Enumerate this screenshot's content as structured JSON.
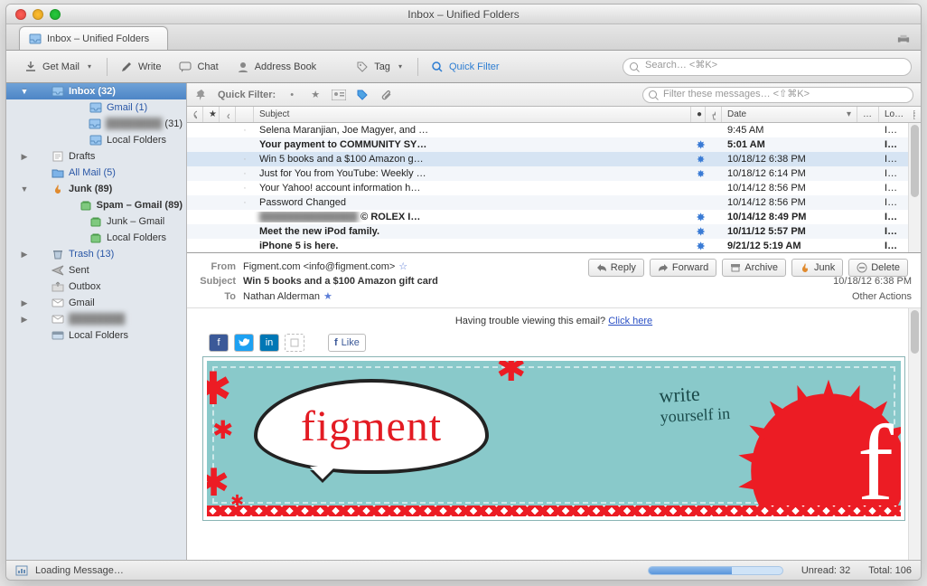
{
  "window": {
    "title": "Inbox – Unified Folders"
  },
  "tab": {
    "label": "Inbox – Unified Folders"
  },
  "toolbar": {
    "get_mail": "Get Mail",
    "write": "Write",
    "chat": "Chat",
    "address_book": "Address Book",
    "tag": "Tag",
    "quick_filter": "Quick Filter",
    "search_placeholder": "Search… <⌘K>"
  },
  "sidebar": {
    "items": [
      {
        "label": "Inbox (32)",
        "icon": "inbox",
        "indent": 1,
        "selected": true,
        "disclosure": "▼"
      },
      {
        "label": "Gmail (1)",
        "icon": "inbox",
        "indent": 2,
        "blue": true
      },
      {
        "label_plain": "",
        "label_suffix": "(31)",
        "icon": "inbox",
        "indent": 2,
        "blurred": true
      },
      {
        "label": "Local Folders",
        "icon": "inbox",
        "indent": 2
      },
      {
        "label": "Drafts",
        "icon": "drafts",
        "indent": 1,
        "disclosure": "▶"
      },
      {
        "label": "All Mail (5)",
        "icon": "folder-blue",
        "indent": 1,
        "blue": true
      },
      {
        "label": "Junk (89)",
        "icon": "junk",
        "indent": 1,
        "disclosure": "▼",
        "bold": true
      },
      {
        "label": "Spam – Gmail (89)",
        "icon": "junk-green",
        "indent": 2,
        "bold": true
      },
      {
        "label": "Junk – Gmail",
        "icon": "junk-green",
        "indent": 2
      },
      {
        "label": "Local Folders",
        "icon": "junk-green",
        "indent": 2
      },
      {
        "label": "Trash (13)",
        "icon": "trash",
        "indent": 1,
        "disclosure": "▶",
        "blue": true
      },
      {
        "label": "Sent",
        "icon": "sent",
        "indent": 1
      },
      {
        "label": "Outbox",
        "icon": "outbox",
        "indent": 1
      },
      {
        "label": "Gmail",
        "icon": "account",
        "indent": 1,
        "disclosure": "▶"
      },
      {
        "label_plain": "",
        "icon": "account",
        "indent": 1,
        "disclosure": "▶",
        "blurred": true
      },
      {
        "label": "Local Folders",
        "icon": "local",
        "indent": 1
      }
    ]
  },
  "quickfilter": {
    "label": "Quick Filter:",
    "filter_placeholder": "Filter these messages… <⇧⌘K>"
  },
  "columns": {
    "subject": "Subject",
    "date": "Date",
    "location_short": "Lo…"
  },
  "messages": [
    {
      "subject": "Selena Maranjian, Joe Magyer, and …",
      "date": "9:45 AM",
      "spark": false,
      "unread": false,
      "loc": "In…"
    },
    {
      "subject": "Your payment to COMMUNITY SY…",
      "date": "5:01 AM",
      "spark": true,
      "unread": true,
      "loc": "In…"
    },
    {
      "subject": "Win 5 books and a $100 Amazon g…",
      "date": "10/18/12 6:38 PM",
      "spark": true,
      "unread": false,
      "sel": true,
      "loc": "In…"
    },
    {
      "subject": "Just for You from YouTube: Weekly …",
      "date": "10/18/12 6:14 PM",
      "spark": true,
      "unread": false,
      "loc": "In…"
    },
    {
      "subject": "Your Yahoo! account information h…",
      "date": "10/14/12 8:56 PM",
      "spark": false,
      "unread": false,
      "loc": "In…"
    },
    {
      "subject": "Password Changed",
      "date": "10/14/12 8:56 PM",
      "spark": false,
      "unread": false,
      "loc": "In…"
    },
    {
      "subject_blurred": true,
      "subject_suffix": " © ROLEX I…",
      "date": "10/14/12 8:49 PM",
      "spark": true,
      "unread": true,
      "loc": "In…"
    },
    {
      "subject": "Meet the new iPod family.",
      "date": "10/11/12 5:57 PM",
      "spark": true,
      "unread": true,
      "loc": "In…"
    },
    {
      "subject": "iPhone 5 is here.",
      "date": "9/21/12 5:19 AM",
      "spark": true,
      "unread": true,
      "loc": "In…"
    }
  ],
  "preview": {
    "from_label": "From",
    "from_value": "Figment.com <info@figment.com>",
    "subject_label": "Subject",
    "subject_value": "Win 5 books and a $100 Amazon gift card",
    "to_label": "To",
    "to_value": "Nathan Alderman",
    "date": "10/18/12 6:38 PM",
    "other_actions": "Other Actions",
    "actions": {
      "reply": "Reply",
      "forward": "Forward",
      "archive": "Archive",
      "junk": "Junk",
      "delete": "Delete"
    },
    "trouble_prefix": "Having trouble viewing this email? ",
    "trouble_link": "Click here",
    "like_label": "Like",
    "banner_brand": "figment",
    "banner_tag1": "write",
    "banner_tag2": "yourself in"
  },
  "status": {
    "loading": "Loading Message…",
    "unread": "Unread: 32",
    "total": "Total: 106"
  }
}
